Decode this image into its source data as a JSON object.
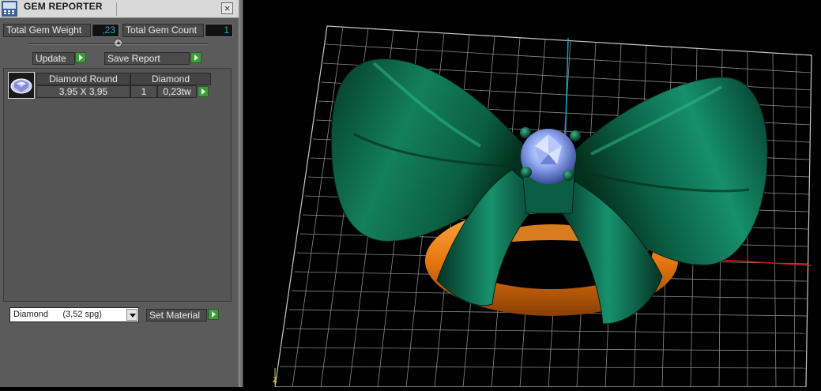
{
  "panel": {
    "title": "GEM REPORTER",
    "close_symbol": "×",
    "total_weight_label": "Total Gem Weight",
    "total_weight_value": ",23",
    "total_count_label": "Total Gem Count",
    "total_count_value": "1",
    "update_label": "Update",
    "save_report_label": "Save Report"
  },
  "gem_table": {
    "headers": [
      "Diamond Round",
      "Diamond"
    ],
    "rows": [
      {
        "size": "3,95 X 3,95",
        "count": "1",
        "weight": "0,23tw"
      }
    ]
  },
  "material": {
    "selected": "Diamond      (3,52 spg)",
    "set_material_label": "Set Material"
  },
  "viewport": {
    "axis_label": "Z"
  },
  "colors": {
    "ribbon": "#0e6b4c",
    "ring": "#e8780f",
    "gem": "#8fa8f0",
    "grid": "#8a8a8a",
    "accent_value": "#29a7c9",
    "go_button": "#3e9a3a"
  }
}
